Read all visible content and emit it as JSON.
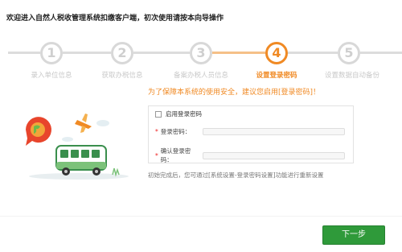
{
  "header": {
    "title": "欢迎进入自然人税收管理系统扣缴客户端，初次使用请按本向导操作"
  },
  "wizard": {
    "steps": [
      {
        "number": "1",
        "label": "录入单位信息",
        "active": false
      },
      {
        "number": "2",
        "label": "获取办税信息",
        "active": false
      },
      {
        "number": "3",
        "label": "备案办税人员信息",
        "active": false
      },
      {
        "number": "4",
        "label": "设置登录密码",
        "active": true
      },
      {
        "number": "5",
        "label": "设置数据自动备份",
        "active": false
      }
    ]
  },
  "tip": "为了保障本系统的使用安全，建议您启用[登录密码]！",
  "form": {
    "enable_label": "启用登录密码",
    "enable_checked": false,
    "password_label": "登录密码：",
    "confirm_label": "确认登录密码：",
    "password_value": "",
    "confirm_value": ""
  },
  "footnote": "初始完成后，您可通过[系统设置-登录密码设置]功能进行重新设置",
  "actions": {
    "next_label": "下一步"
  },
  "colors": {
    "accent": "#f08a24",
    "inactive": "#d8d8d8",
    "primary_button": "#2f9a3a"
  }
}
